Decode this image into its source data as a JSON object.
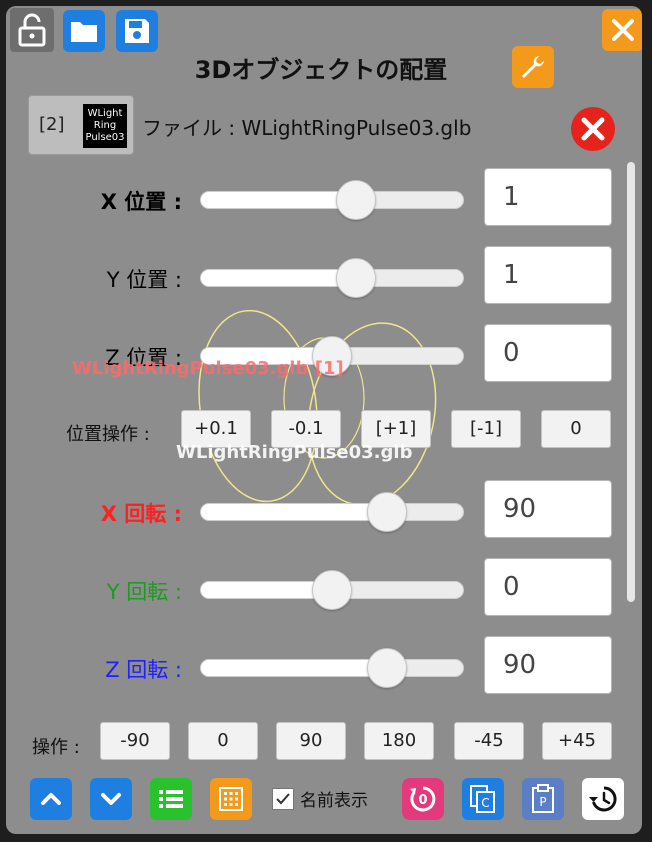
{
  "title": "3Dオブジェクトの配置",
  "file": {
    "index": "[2]",
    "thumb_lines": [
      "WLight",
      "Ring",
      "Pulse03"
    ],
    "label": "ファイル : WLightRingPulse03.glb"
  },
  "position": {
    "x": {
      "label": "X 位置 :",
      "value": "1",
      "level": 0.59
    },
    "y": {
      "label": "Y 位置 :",
      "value": "1",
      "level": 0.59
    },
    "z": {
      "label": "Z 位置 :",
      "value": "0",
      "level": 0.5
    },
    "ops_label": "位置操作 :",
    "ops": [
      "+0.1",
      "-0.1",
      "[+1]",
      "[-1]",
      "0"
    ]
  },
  "rotation": {
    "x": {
      "label": "X 回転 :",
      "value": "90",
      "level": 0.71
    },
    "y": {
      "label": "Y 回転 :",
      "value": "0",
      "level": 0.5
    },
    "z": {
      "label": "Z 回転 :",
      "value": "90",
      "level": 0.71
    },
    "ops_label": "操作 :",
    "ops": [
      "-90",
      "0",
      "90",
      "180",
      "-45",
      "+45"
    ]
  },
  "overlays": {
    "red_text": "WLightRingPulse03.glb [1]",
    "white_text": "WLightRingPulse03.glb"
  },
  "bottom_bar": {
    "show_names_label": "名前表示",
    "show_names_checked": true,
    "reset_icon_text": "0",
    "copy_icon_text": "C",
    "paste_icon_text": "P"
  },
  "colors": {
    "rot_x": "#ff2020",
    "rot_y": "#1f9a1f",
    "rot_z": "#2020ff",
    "pos": "#111111",
    "accent_blue": "#1f7fe0",
    "accent_orange": "#f39a1d",
    "accent_green": "#27c22c",
    "danger_red": "#e5231b"
  }
}
